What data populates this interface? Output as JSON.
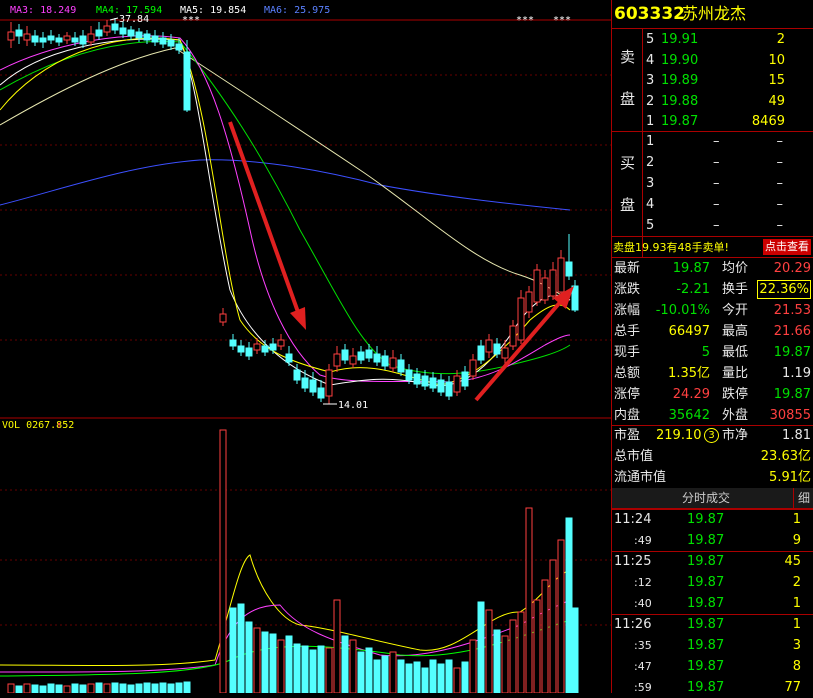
{
  "chart_data": [
    {
      "type": "candlestick",
      "legend": {
        "ma3": "MA3: 18.249",
        "ma4": "MA4: 17.594",
        "ma5": "MA5: 19.854",
        "ma6": "MA6: 25.975"
      },
      "annotations": {
        "high": "37.84",
        "low": "14.01",
        "suspend_marks": "***"
      },
      "colors": {
        "ma3": "#ff40ff",
        "ma4": "#00ff00",
        "ma5": "#ffffff",
        "ma6": "#4060ff",
        "up": "#ff4040",
        "down": "#54ffff",
        "arrow": "#ff3030"
      }
    },
    {
      "type": "bar",
      "legend": {
        "vol": "VOL 0267.852"
      },
      "colors": {
        "up": "#ff4040",
        "down": "#54ffff"
      }
    }
  ],
  "quote": {
    "code": "603332",
    "name": "苏州龙杰",
    "sell_label": [
      "卖",
      "盘"
    ],
    "buy_label": [
      "买",
      "盘"
    ],
    "sell": [
      {
        "level": "5",
        "price": "19.91",
        "vol": "2"
      },
      {
        "level": "4",
        "price": "19.90",
        "vol": "10"
      },
      {
        "level": "3",
        "price": "19.89",
        "vol": "15"
      },
      {
        "level": "2",
        "price": "19.88",
        "vol": "49"
      },
      {
        "level": "1",
        "price": "19.87",
        "vol": "8469"
      }
    ],
    "buy": [
      {
        "level": "1",
        "price": "–",
        "vol": "–"
      },
      {
        "level": "2",
        "price": "–",
        "vol": "–"
      },
      {
        "level": "3",
        "price": "–",
        "vol": "–"
      },
      {
        "level": "4",
        "price": "–",
        "vol": "–"
      },
      {
        "level": "5",
        "price": "–",
        "vol": "–"
      }
    ],
    "notice": "卖盘19.93有48手卖单!",
    "notice_btn": "点击查看",
    "stats": [
      {
        "k1": "最新",
        "v1": "19.87",
        "k2": "均价",
        "v2": "20.29"
      },
      {
        "k1": "涨跌",
        "v1": "-2.21",
        "k2": "换手",
        "v2": "22.36%"
      },
      {
        "k1": "涨幅",
        "v1": "-10.01%",
        "k2": "今开",
        "v2": "21.53"
      },
      {
        "k1": "总手",
        "v1": "66497",
        "k2": "最高",
        "v2": "21.66"
      },
      {
        "k1": "现手",
        "v1": "5",
        "k2": "最低",
        "v2": "19.87"
      },
      {
        "k1": "总额",
        "v1": "1.35亿",
        "k2": "量比",
        "v2": "1.19"
      },
      {
        "k1": "涨停",
        "v1": "24.29",
        "k2": "跌停",
        "v2": "19.87"
      },
      {
        "k1": "内盘",
        "v1": "35642",
        "k2": "外盘",
        "v2": "30855"
      }
    ],
    "valuation": [
      {
        "k": "市盈",
        "v": "219.10",
        "badge": "3",
        "k2": "市净",
        "v2": "1.81"
      },
      {
        "k": "总市值",
        "v": "23.63亿"
      },
      {
        "k": "流通市值",
        "v": "5.91亿"
      }
    ],
    "ticks_title": "分时成交",
    "ticks_btn": "细",
    "ticks": [
      {
        "time": "11:24",
        "price": "19.87",
        "vol": "1"
      },
      {
        "time": ":49",
        "price": "19.87",
        "vol": "9"
      },
      {
        "time": "11:25",
        "price": "19.87",
        "vol": "45"
      },
      {
        "time": ":12",
        "price": "19.87",
        "vol": "2"
      },
      {
        "time": ":40",
        "price": "19.87",
        "vol": "1"
      },
      {
        "time": "11:26",
        "price": "19.87",
        "vol": "1"
      },
      {
        "time": ":35",
        "price": "19.87",
        "vol": "3"
      },
      {
        "time": ":47",
        "price": "19.87",
        "vol": "8"
      },
      {
        "time": ":59",
        "price": "19.87",
        "vol": "77"
      }
    ]
  }
}
